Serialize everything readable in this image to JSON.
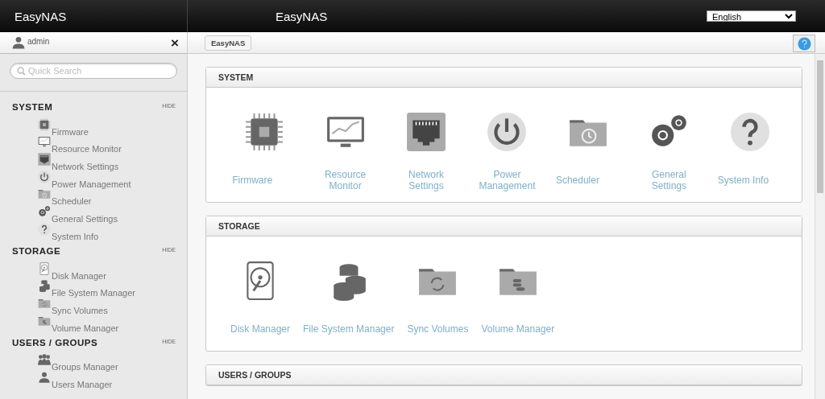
{
  "topbar": {
    "sidebar_title": "EasyNAS",
    "title": "EasyNAS",
    "language": "English"
  },
  "sidebar": {
    "user": "admin",
    "close": "×",
    "search": {
      "placeholder": "Quick Search"
    },
    "sections": [
      {
        "title": "SYSTEM",
        "toggle": "HIDE",
        "items": [
          {
            "label": "Firmware",
            "kind": "chip"
          },
          {
            "label": "Resource Monitor",
            "kind": "monitor"
          },
          {
            "label": "Network Settings",
            "kind": "ethernet"
          },
          {
            "label": "Power Management",
            "kind": "power"
          },
          {
            "label": "Scheduler",
            "kind": "scheduler"
          },
          {
            "label": "General Settings",
            "kind": "gears"
          },
          {
            "label": "System Info",
            "kind": "question"
          }
        ]
      },
      {
        "title": "STORAGE",
        "toggle": "HIDE",
        "items": [
          {
            "label": "Disk Manager",
            "kind": "disk"
          },
          {
            "label": "File System Manager",
            "kind": "database"
          },
          {
            "label": "Sync Volumes",
            "kind": "sync"
          },
          {
            "label": "Volume Manager",
            "kind": "volume"
          }
        ]
      },
      {
        "title": "USERS / GROUPS",
        "toggle": "HIDE",
        "items": [
          {
            "label": "Groups Manager",
            "kind": "groups"
          },
          {
            "label": "Users Manager",
            "kind": "user"
          }
        ]
      }
    ]
  },
  "breadcrumb": "EasyNAS",
  "panels": [
    {
      "title": "SYSTEM",
      "tiles": [
        {
          "label": "Firmware",
          "kind": "chip"
        },
        {
          "label": "Resource Monitor",
          "kind": "monitor"
        },
        {
          "label": "Network Settings",
          "kind": "ethernet"
        },
        {
          "label": "Power Management",
          "kind": "power"
        },
        {
          "label": "Scheduler",
          "kind": "scheduler"
        },
        {
          "label": "General Settings",
          "kind": "gears"
        },
        {
          "label": "System Info",
          "kind": "question"
        }
      ]
    },
    {
      "title": "STORAGE",
      "tiles": [
        {
          "label": "Disk Manager",
          "kind": "disk"
        },
        {
          "label": "File System Manager",
          "kind": "database"
        },
        {
          "label": "Sync Volumes",
          "kind": "sync"
        },
        {
          "label": "Volume Manager",
          "kind": "volume"
        }
      ]
    },
    {
      "title": "USERS / GROUPS"
    }
  ]
}
